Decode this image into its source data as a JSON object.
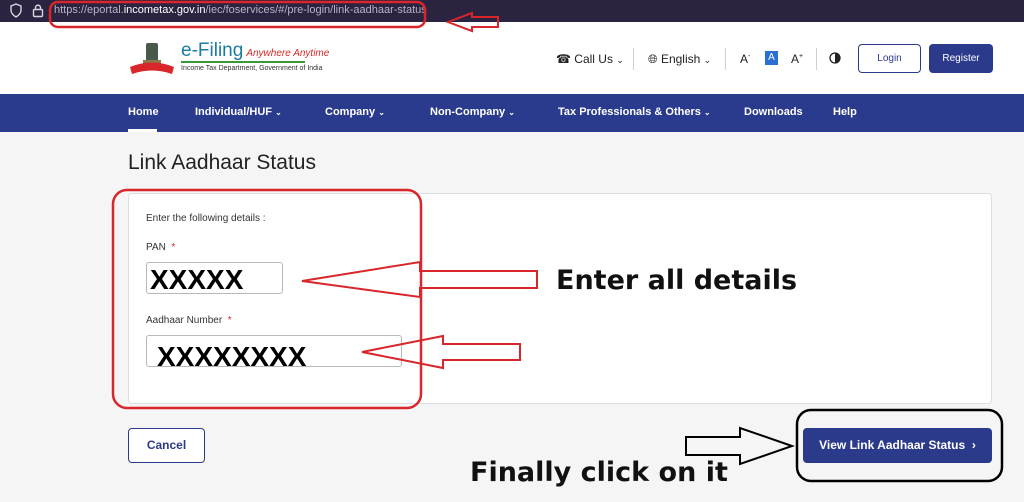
{
  "browser": {
    "url_prefix": "https://eportal.",
    "url_domain": "incometax.gov.in",
    "url_path": "/iec/foservices/#/pre-login/link-aadhaar-status"
  },
  "header": {
    "logo_title": "e-Filing",
    "logo_tagline": "Anywhere Anytime",
    "logo_subtitle": "Income Tax Department, Government of India",
    "call_us": "Call Us",
    "language": "English",
    "font_decrease": "A",
    "font_normal": "A",
    "font_increase": "A",
    "login": "Login",
    "register": "Register"
  },
  "nav": {
    "items": [
      "Home",
      "Individual/HUF",
      "Company",
      "Non-Company",
      "Tax Professionals & Others",
      "Downloads",
      "Help"
    ]
  },
  "page": {
    "title": "Link Aadhaar Status",
    "instructions": "Enter the following details :",
    "pan_label": "PAN",
    "pan_value": "XXXXX",
    "aadhaar_label": "Aadhaar Number",
    "aadhaar_value": "XXXXXXXX",
    "required_mark": "*",
    "cancel": "Cancel",
    "view_status": "View Link Aadhaar Status"
  },
  "annotations": {
    "enter_details": "Enter all details",
    "click_note": "Finally click on it"
  },
  "colors": {
    "primary": "#2c3a8c",
    "annotation_red": "#d8262b"
  }
}
